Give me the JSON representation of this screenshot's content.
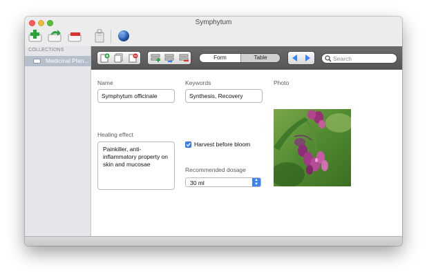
{
  "window": {
    "title": "Symphytum"
  },
  "toolbar": {
    "buttons": [
      {
        "name": "new-collection-icon"
      },
      {
        "name": "duplicate-collection-icon"
      },
      {
        "name": "delete-collection-icon"
      },
      {
        "name": "file-manager-icon"
      },
      {
        "name": "sync-globe-icon"
      }
    ]
  },
  "sidebar": {
    "heading": "COLLECTIONS",
    "items": [
      {
        "label": "Medicinal Plan...",
        "selected": true
      }
    ]
  },
  "view": {
    "record_buttons": [
      "new-record-icon",
      "duplicate-record-icon",
      "delete-record-icon"
    ],
    "field_buttons": [
      "add-field-icon",
      "move-field-icon",
      "delete-field-icon"
    ],
    "mode_tabs": {
      "form": "Form",
      "table": "Table",
      "active": "Form"
    },
    "nav": [
      "previous-arrow-icon",
      "next-arrow-icon"
    ],
    "search": {
      "placeholder": "Search"
    }
  },
  "form": {
    "name": {
      "label": "Name",
      "value": "Symphytum officinale"
    },
    "keywords": {
      "label": "Keywords",
      "value": "Synthesis, Recovery"
    },
    "photo": {
      "label": "Photo"
    },
    "healing_effect": {
      "label": "Healing effect",
      "value": "Painkiller, anti-inflammatory property on skin and mucosae"
    },
    "harvest": {
      "label": "Harvest before bloom",
      "checked": true
    },
    "dosage": {
      "label": "Recommended dosage",
      "value": "30 ml"
    }
  },
  "colors": {
    "accent": "#3b83f6",
    "selection": "#b5bfcc",
    "toolbar_dark": "#5f5f5f"
  }
}
